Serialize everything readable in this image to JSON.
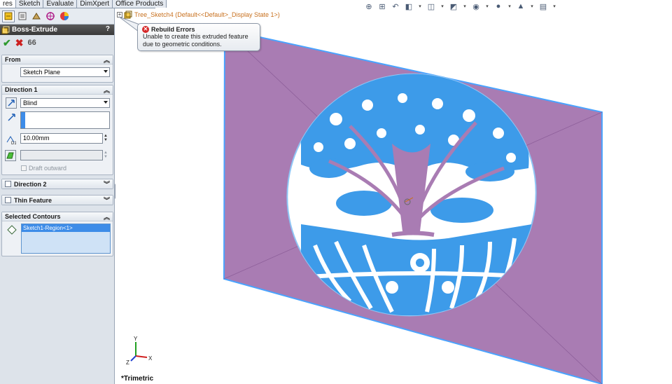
{
  "command_tabs": [
    "res",
    "Sketch",
    "Evaluate",
    "DimXpert",
    "Office Products"
  ],
  "property_manager": {
    "title": "Boss-Extrude",
    "help": "?",
    "from": {
      "label": "From",
      "value": "Sketch Plane"
    },
    "direction1": {
      "label": "Direction 1",
      "end_condition": "Blind",
      "depth": "10.00mm",
      "draft_outward": "Draft outward"
    },
    "direction2": {
      "label": "Direction 2"
    },
    "thin_feature": {
      "label": "Thin Feature"
    },
    "selected_contours": {
      "label": "Selected Contours",
      "items": [
        "Sketch1-Region<1>"
      ]
    }
  },
  "feature_tree": {
    "part_label": "Tree_Sketch4  (Default<<Default>_Display State 1>)"
  },
  "rebuild_error": {
    "title": "Rebuild Errors",
    "message_line1": "Unable to create this extruded feature",
    "message_line2": "due to geometric conditions."
  },
  "view": {
    "orientation_label": "*Trimetric",
    "axes": {
      "x": "X",
      "y": "Y",
      "z": "Z"
    }
  },
  "colors": {
    "plane_fill": "#a97cb3",
    "sketch_blue": "#3d9be9",
    "edge_blue": "#4aa3ff"
  }
}
